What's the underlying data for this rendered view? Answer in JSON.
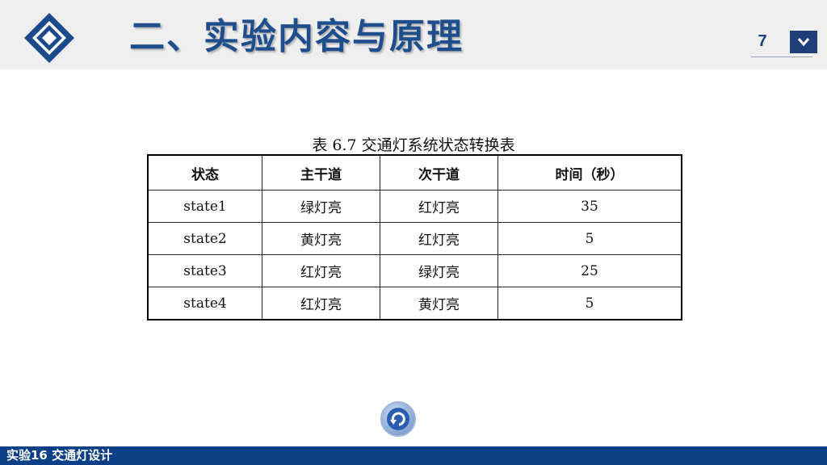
{
  "header": {
    "title": "二、实验内容与原理",
    "page_number": "7",
    "colors": {
      "band": "#efefef",
      "title": "#1f4e8c",
      "accent": "#1e3f78"
    }
  },
  "content": {
    "caption": "表 6.7   交通灯系统状态转换表",
    "table": {
      "headers": [
        "状态",
        "主干道",
        "次干道",
        "时间（秒）"
      ],
      "rows": [
        [
          "state1",
          "绿灯亮",
          "红灯亮",
          "35"
        ],
        [
          "state2",
          "黄灯亮",
          "红灯亮",
          "5"
        ],
        [
          "state3",
          "红灯亮",
          "绿灯亮",
          "25"
        ],
        [
          "state4",
          "红灯亮",
          "黄灯亮",
          "5"
        ]
      ]
    }
  },
  "icons": {
    "logo": "diamond-logo-icon",
    "nav": "chevron-down-icon",
    "back": "return-arrow-icon"
  },
  "footer": {
    "text": "实验16 交通灯设计",
    "color": "#0b3f86"
  }
}
